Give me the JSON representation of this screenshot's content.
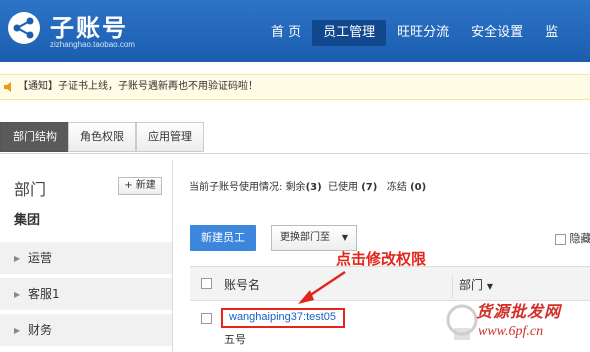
{
  "header": {
    "brand_title": "子账号",
    "brand_sub": "zizhanghao.taobao.com",
    "nav": [
      "首 页",
      "员工管理",
      "旺旺分流",
      "安全设置",
      "监"
    ]
  },
  "notice": {
    "text": "【通知】子证书上线，子账号遇新再也不用验证码啦！"
  },
  "tabs": [
    "部门结构",
    "角色权限",
    "应用管理"
  ],
  "sidebar": {
    "title": "部门",
    "new_button": "+ 新建",
    "group": "集团",
    "items": [
      "运营",
      "客服1",
      "财务"
    ]
  },
  "main": {
    "usage_label": "当前子账号使用情况:",
    "remaining_label": "剩余",
    "remaining": "(3)",
    "used_label": "已使用",
    "used": "(7)",
    "frozen_label": "冻结",
    "frozen": "(0)",
    "new_employee_button": "新建员工",
    "change_dept_button": "更换部门至",
    "hide_option": "隐藏",
    "table": {
      "col_account": "账号名",
      "col_dept": "部门",
      "rows": [
        {
          "account": "wanghaiping37:test05",
          "name": "五号"
        }
      ]
    }
  },
  "annotation": "点击修改权限",
  "watermark": {
    "line1": "货源批发网",
    "line2": "www.6pf.cn"
  },
  "colors": {
    "header": "#1b5eb0",
    "accent": "#3d86dd",
    "annotation": "#e4251b"
  }
}
